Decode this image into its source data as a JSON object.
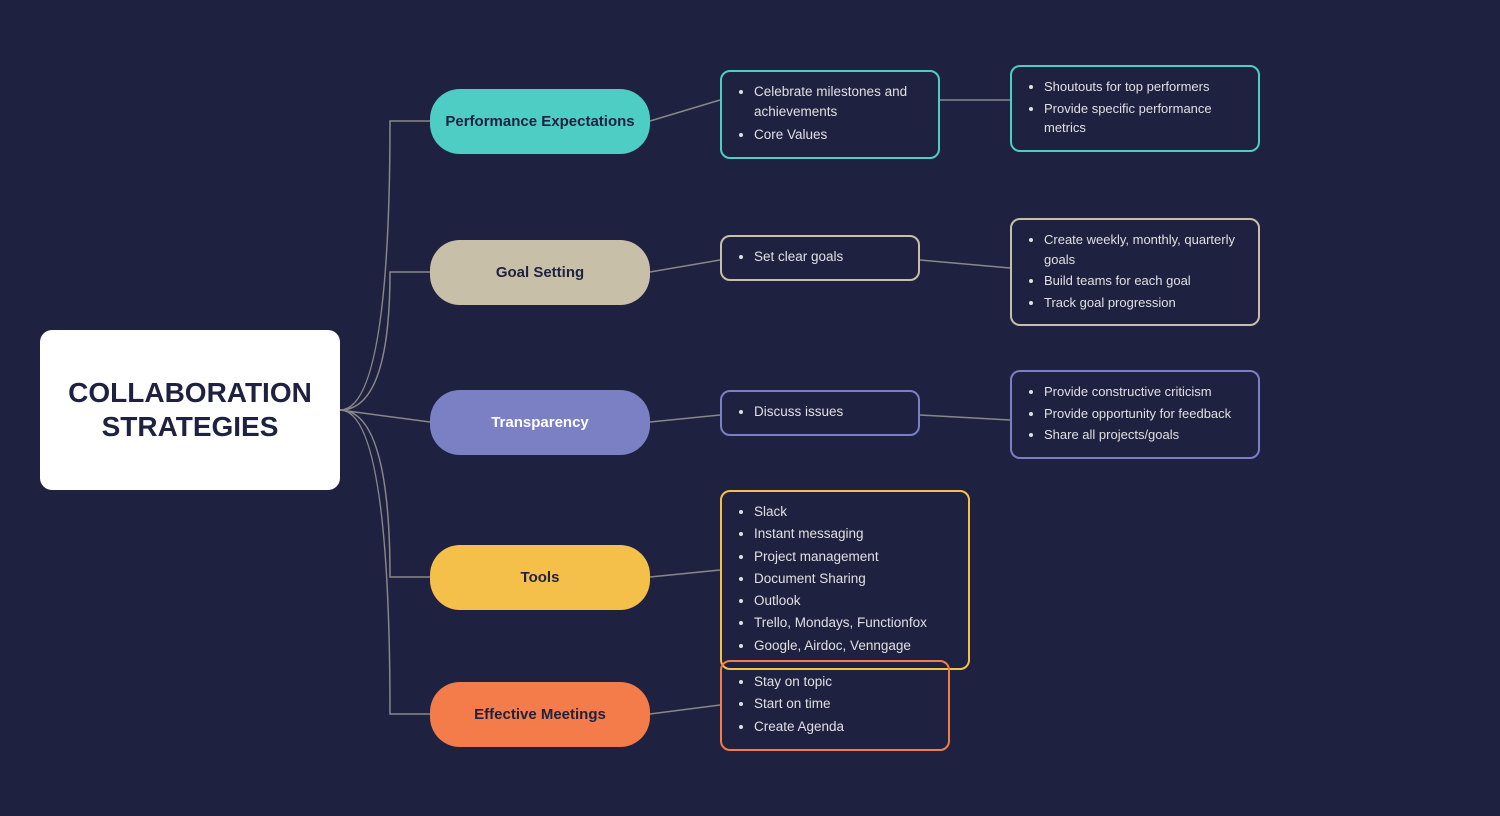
{
  "central": {
    "line1": "COLLABORATION",
    "line2": "STRATEGIES"
  },
  "branches": [
    {
      "id": "perf",
      "label": "Performance Expectations",
      "bg": "#4ecdc4",
      "color": "#1e2240",
      "level2": {
        "items": [
          "Celebrate milestones and achievements",
          "Core Values"
        ]
      },
      "level3": {
        "items": [
          "Shoutouts for top performers",
          "Provide specific performance metrics"
        ]
      }
    },
    {
      "id": "goal",
      "label": "Goal Setting",
      "bg": "#c8bfa8",
      "color": "#1e2240",
      "level2": {
        "items": [
          "Set clear goals"
        ]
      },
      "level3": {
        "items": [
          "Create weekly, monthly, quarterly goals",
          "Build teams for each goal",
          "Track goal progression"
        ]
      }
    },
    {
      "id": "trans",
      "label": "Transparency",
      "bg": "#7b7fc4",
      "color": "#ffffff",
      "level2": {
        "items": [
          "Discuss issues"
        ]
      },
      "level3": {
        "items": [
          "Provide constructive criticism",
          "Provide opportunity for feedback",
          "Share all projects/goals"
        ]
      }
    },
    {
      "id": "tools",
      "label": "Tools",
      "bg": "#f4c04a",
      "color": "#1e2240",
      "level2": {
        "items": [
          "Slack",
          "Instant messaging",
          "Project management",
          "Document Sharing",
          "Outlook",
          "Trello, Mondays, Functionfox",
          "Google, Airdoc, Venngage"
        ]
      },
      "level3": null
    },
    {
      "id": "meetings",
      "label": "Effective Meetings",
      "bg": "#f47b4a",
      "color": "#1e2240",
      "level2": {
        "items": [
          "Stay on topic",
          "Start on time",
          "Create Agenda"
        ]
      },
      "level3": null
    }
  ]
}
